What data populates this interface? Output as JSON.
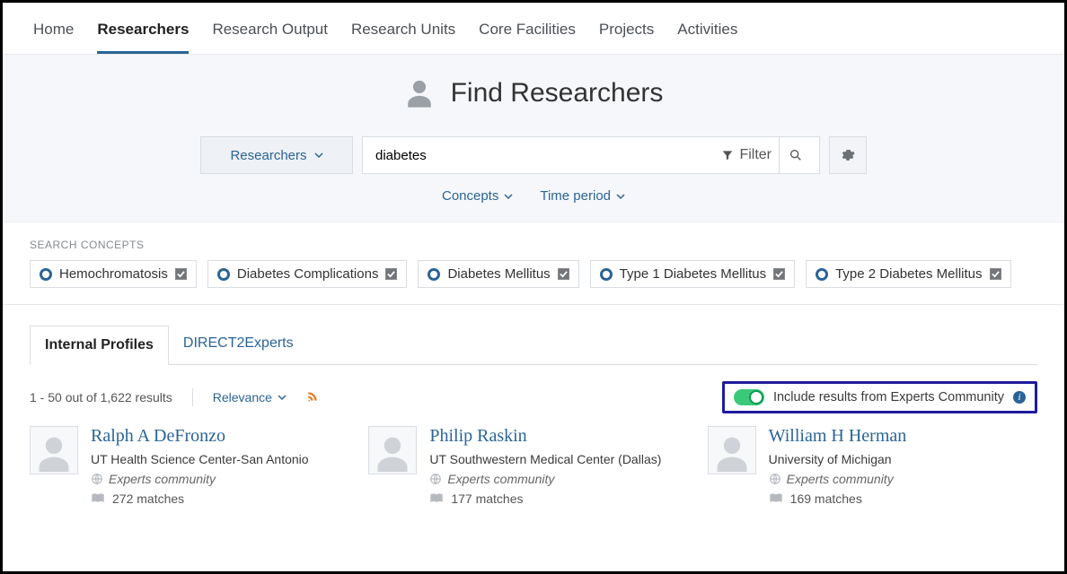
{
  "nav": [
    "Home",
    "Researchers",
    "Research Output",
    "Research Units",
    "Core Facilities",
    "Projects",
    "Activities"
  ],
  "nav_active": 1,
  "hero": {
    "title": "Find Researchers"
  },
  "search": {
    "type_label": "Researchers",
    "query": "diabetes",
    "filter_label": "Filter"
  },
  "sub_filters": [
    "Concepts",
    "Time period"
  ],
  "concepts_header": "SEARCH CONCEPTS",
  "concepts": [
    "Hemochromatosis",
    "Diabetes Complications",
    "Diabetes Mellitus",
    "Type 1 Diabetes Mellitus",
    "Type 2 Diabetes Mellitus"
  ],
  "tabs": [
    "Internal Profiles",
    "DIRECT2Experts"
  ],
  "tabs_active": 0,
  "results_summary": "1 - 50 out of 1,622 results",
  "sort_label": "Relevance",
  "community_toggle_label": "Include results from Experts Community",
  "community_source_label": "Experts community",
  "results": [
    {
      "name": "Ralph A DeFronzo",
      "institution": "UT Health Science Center-San Antonio",
      "matches": "272 matches"
    },
    {
      "name": "Philip Raskin",
      "institution": "UT Southwestern Medical Center (Dallas)",
      "matches": "177 matches"
    },
    {
      "name": "William H Herman",
      "institution": "University of Michigan",
      "matches": "169 matches"
    }
  ]
}
